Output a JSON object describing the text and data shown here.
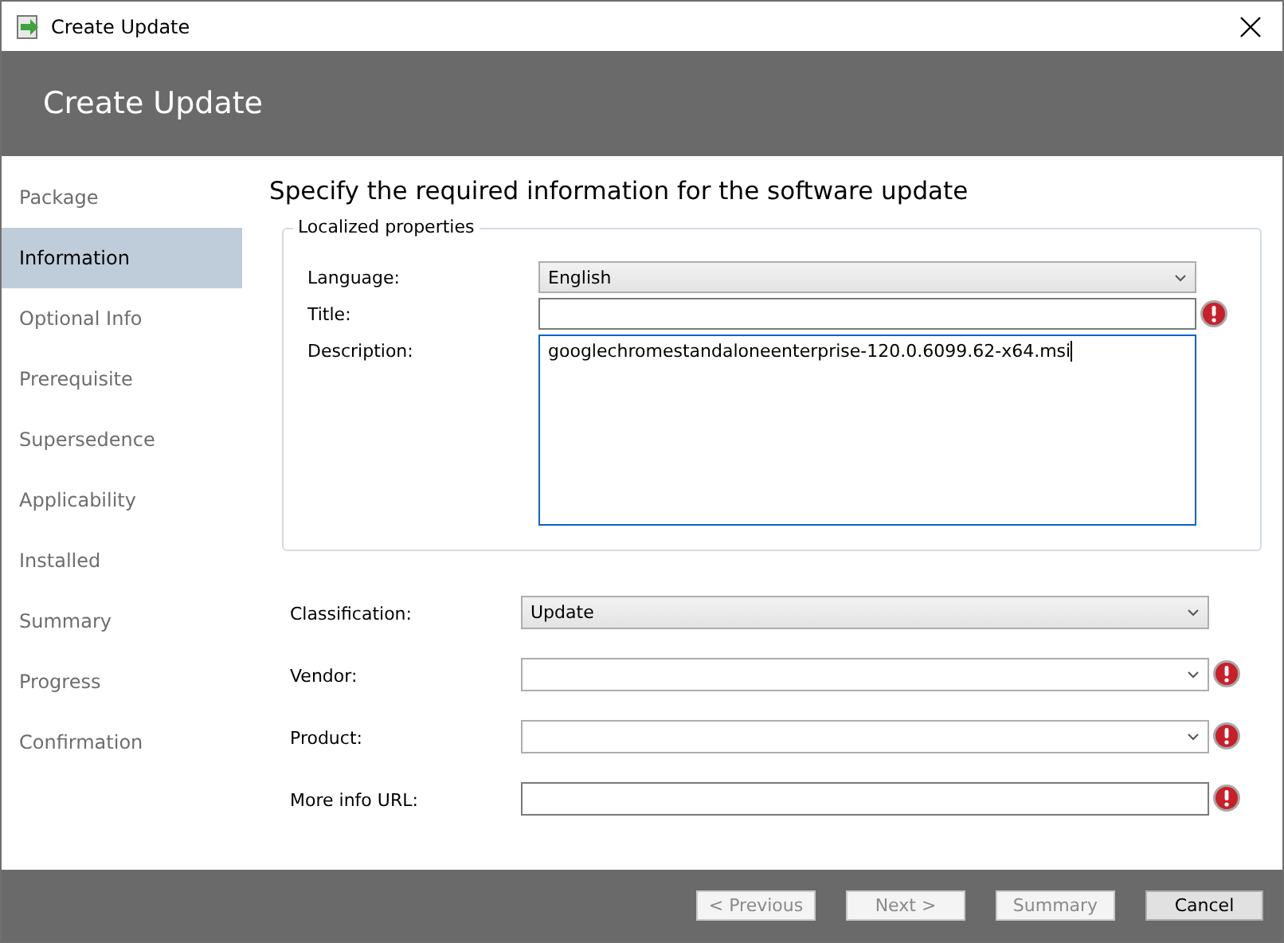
{
  "window": {
    "title": "Create Update"
  },
  "header": {
    "title": "Create Update"
  },
  "sidebar": {
    "items": [
      {
        "label": "Package",
        "selected": false
      },
      {
        "label": "Information",
        "selected": true
      },
      {
        "label": "Optional Info",
        "selected": false
      },
      {
        "label": "Prerequisite",
        "selected": false
      },
      {
        "label": "Supersedence",
        "selected": false
      },
      {
        "label": "Applicability",
        "selected": false
      },
      {
        "label": "Installed",
        "selected": false
      },
      {
        "label": "Summary",
        "selected": false
      },
      {
        "label": "Progress",
        "selected": false
      },
      {
        "label": "Confirmation",
        "selected": false
      }
    ]
  },
  "heading": "Specify the required information for the software update",
  "localized_properties": {
    "legend": "Localized properties",
    "fields": [
      {
        "kind": "combo",
        "label": "Language:",
        "value": "English",
        "error": false
      },
      {
        "kind": "text",
        "label": "Title:",
        "error": true
      },
      {
        "kind": "textarea",
        "label": "Description:",
        "value": "googlechromestandaloneenterprise-120.0.6099.62-x64.msi",
        "error": false,
        "focused": true
      }
    ]
  },
  "fields": [
    {
      "kind": "combo",
      "label": "Classification:",
      "value": "Update",
      "error": false,
      "filled": true
    },
    {
      "kind": "combo",
      "label": "Vendor:",
      "error": true,
      "filled": false
    },
    {
      "kind": "combo",
      "label": "Product:",
      "error": true,
      "filled": false
    },
    {
      "kind": "text",
      "label": "More info URL:",
      "error": true
    }
  ],
  "buttons": [
    {
      "label": "< Previous",
      "disabled": true
    },
    {
      "label": "Next >",
      "disabled": true
    },
    {
      "label": "Summary",
      "disabled": true
    },
    {
      "label": "Cancel",
      "disabled": false
    }
  ]
}
